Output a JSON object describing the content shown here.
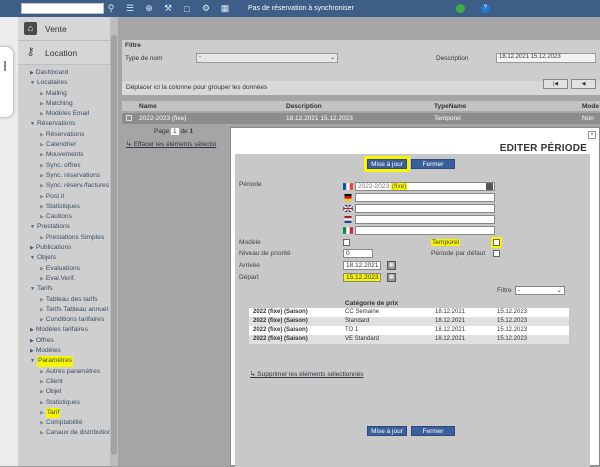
{
  "topbar": {
    "search_placeholder": "",
    "status_text": "Pas de réservation à synchroniser",
    "icons": [
      "search-icon",
      "list-icon",
      "plus-icon",
      "tools-icon",
      "note-icon",
      "gear-icon",
      "grid-icon",
      "sync-icon",
      "help-icon"
    ]
  },
  "sidebar": {
    "sale_label": "Vente",
    "rental_label": "Location",
    "items": [
      {
        "label": "Dashboard",
        "level": 1,
        "arrow": "right"
      },
      {
        "label": "Locataires",
        "level": 1,
        "arrow": "down"
      },
      {
        "label": "Mailing",
        "level": 2
      },
      {
        "label": "Matching",
        "level": 2
      },
      {
        "label": "Modèles Email",
        "level": 2
      },
      {
        "label": "Réservations",
        "level": 1,
        "arrow": "down"
      },
      {
        "label": "Réservations",
        "level": 2
      },
      {
        "label": "Calendrier",
        "level": 2
      },
      {
        "label": "Mouvements",
        "level": 2
      },
      {
        "label": "Sync. offres",
        "level": 2
      },
      {
        "label": "Sync. réservations",
        "level": 2
      },
      {
        "label": "Sync. réserv./factures",
        "level": 2
      },
      {
        "label": "Post it",
        "level": 2
      },
      {
        "label": "Statistiques",
        "level": 2
      },
      {
        "label": "Cautions",
        "level": 2
      },
      {
        "label": "Prestations",
        "level": 1,
        "arrow": "down"
      },
      {
        "label": "Prestations Simples",
        "level": 2
      },
      {
        "label": "Publications",
        "level": 1,
        "arrow": "right"
      },
      {
        "label": "Objets",
        "level": 1,
        "arrow": "down"
      },
      {
        "label": "Evaluations",
        "level": 2
      },
      {
        "label": "Eval.Verif.",
        "level": 2
      },
      {
        "label": "Tarifs",
        "level": 1,
        "arrow": "down"
      },
      {
        "label": "Tableau des tarifs",
        "level": 2
      },
      {
        "label": "Tarifs Tableau annuel",
        "level": 2
      },
      {
        "label": "Conditions tarifaires",
        "level": 2
      },
      {
        "label": "Modèles tarifaires",
        "level": 1,
        "arrow": "right"
      },
      {
        "label": "Offres",
        "level": 1,
        "arrow": "right"
      },
      {
        "label": "Modèles",
        "level": 1,
        "arrow": "right"
      },
      {
        "label": "Paramètres",
        "level": 1,
        "arrow": "down",
        "highlight": true
      },
      {
        "label": "Autres paramètres",
        "level": 2
      },
      {
        "label": "Client",
        "level": 2
      },
      {
        "label": "Objet",
        "level": 2
      },
      {
        "label": "Statistiques",
        "level": 2
      },
      {
        "label": "Tarif",
        "level": 2,
        "highlight": true
      },
      {
        "label": "Comptabilité",
        "level": 2
      },
      {
        "label": "Canaux de distribution",
        "level": 2
      }
    ]
  },
  "filter": {
    "title": "Filtre",
    "type_label": "Type de nom",
    "type_value": "-",
    "description_label": "Description",
    "description_value": "18.12.2021 15.12.2023"
  },
  "grid": {
    "group_hint": "Déplacer ici la colonne pour grouper les données",
    "columns": [
      "Name",
      "Description",
      "TypeName",
      "Mode"
    ],
    "row": [
      "2022-2023 (fixe)",
      "18.12.2021 15.12.2023",
      "Temporel",
      "Non"
    ],
    "page_label": "Page",
    "page_num": "1",
    "page_of": "de",
    "page_total": "1",
    "delete_link": "Effacer les éléments sélectio"
  },
  "dialog": {
    "title": "EDITER PÉRIODE",
    "save_label": "Mise à jour",
    "close_label": "Fermer",
    "period_label": "Période",
    "period_fr_value": "2022-2023",
    "period_fr_suffix": "(fixe)",
    "model_label": "Modèle",
    "temporal_label": "Temporel",
    "priority_label": "Niveau de priorité",
    "priority_value": "0",
    "default_period_label": "Période par défaut",
    "arrival_label": "Arrivée",
    "arrival_value": "18.12.2021",
    "departure_label": "Départ",
    "departure_value": "15.12.2023",
    "filter_label": "Filtre",
    "filter_value": "-",
    "table_header": "Catégorie de prix",
    "rows": [
      [
        "2022 (fixe) (Saison)",
        "CC Semaine",
        "18.12.2021",
        "15.12.2023"
      ],
      [
        "2022 (fixe) (Saison)",
        "Standard",
        "18.12.2021",
        "15.12.2023"
      ],
      [
        "2022 (fixe) (Saison)",
        "TO 1",
        "18.12.2021",
        "15.12.2023"
      ],
      [
        "2022 (fixe) (Saison)",
        "VE Standard",
        "18.12.2021",
        "15.12.2023"
      ]
    ],
    "delete_selected": "Supprimer les éléments sélectionnés"
  },
  "colors": {
    "topbar": "#3d5e86",
    "button": "#3b5f9b",
    "highlight": "#f7f500"
  }
}
